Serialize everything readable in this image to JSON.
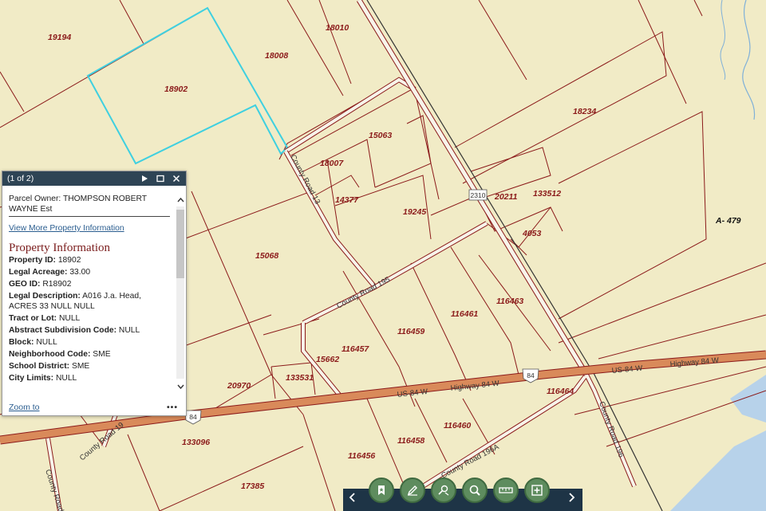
{
  "map": {
    "parcels": [
      "19194",
      "18010",
      "18008",
      "18902",
      "18234",
      "15063",
      "18007",
      "14377",
      "20211",
      "133512",
      "19245",
      "4053",
      "15068",
      "116461",
      "116463",
      "116459",
      "116457",
      "15662",
      "133531",
      "20970",
      "116464",
      "116460",
      "116458",
      "133096",
      "116456",
      "17385"
    ],
    "area_label": "A- 479",
    "roads": {
      "county_road_13": "County Road 13",
      "county_road_195": "County Road 195",
      "us84_w": "US-84 W",
      "highway_84_w_1": "Highway 84 W",
      "us84_w_2": "US-84 W",
      "highway_84_w_2": "Highway 84 W",
      "county_road_196": "County Road 196",
      "county_road_196a": "County Road 196A",
      "county_road_19_left": "County Road 19",
      "county_road_left_bottom": "County Road"
    },
    "shields": {
      "s2310": "2310",
      "s84_center": "84",
      "s84_left": "84"
    },
    "colors": {
      "land": "#f1ebc6",
      "parcel_line": "#8b1a1a",
      "highlight": "#3fd0e0",
      "highway": "#d98a5a",
      "water": "#b7d2ea"
    }
  },
  "popup": {
    "counter": "(1 of 2)",
    "owner_label": "Parcel Owner:",
    "owner_value": "THOMPSON ROBERT WAYNE Est",
    "view_more": "View More Property Information",
    "section_title": "Property Information",
    "fields": [
      {
        "label": "Property ID:",
        "value": "18902"
      },
      {
        "label": "Legal Acreage:",
        "value": "33.00"
      },
      {
        "label": "GEO ID:",
        "value": "R18902"
      },
      {
        "label": "Legal Description:",
        "value": "A016 J.a. Head, ACRES 33 NULL NULL"
      },
      {
        "label": "Tract or Lot:",
        "value": "NULL"
      },
      {
        "label": "Abstract Subdivision Code:",
        "value": "NULL"
      },
      {
        "label": "Block:",
        "value": "NULL"
      },
      {
        "label": "Neighborhood Code:",
        "value": "SME"
      },
      {
        "label": "School District:",
        "value": "SME"
      },
      {
        "label": "City Limits:",
        "value": "NULL"
      }
    ],
    "zoom_to": "Zoom to",
    "more": "•••"
  },
  "toolbar": {
    "tools": [
      "bookmark-icon",
      "draw-icon",
      "measure-icon",
      "search-icon",
      "scale-icon",
      "add-data-icon"
    ],
    "color": "#5e8c5e"
  }
}
